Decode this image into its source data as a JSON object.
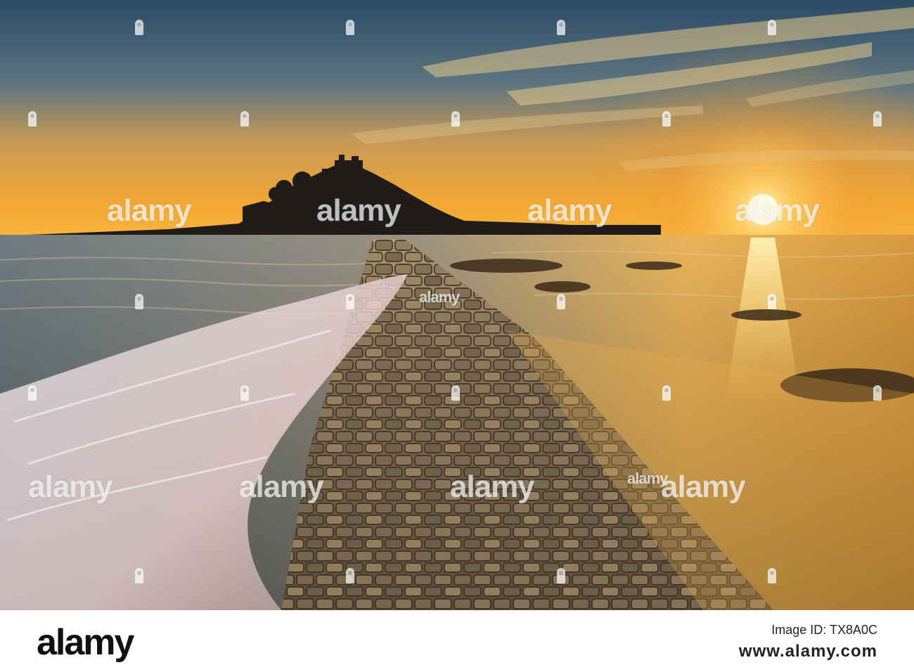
{
  "watermark": {
    "brand": "alamy"
  },
  "footer": {
    "logo": "alamy",
    "caption": "Image ID: TX8A0C",
    "url": "www.alamy.com"
  },
  "scene": {
    "subject": "island castle silhouette at sunset with cobbled causeway",
    "colors": {
      "sky_top": "#2b4a66",
      "sky_horizon": "#f4a532",
      "sun": "#fff3b0",
      "sea": "#7d8a8c",
      "causeway": "#6a5a45"
    }
  }
}
